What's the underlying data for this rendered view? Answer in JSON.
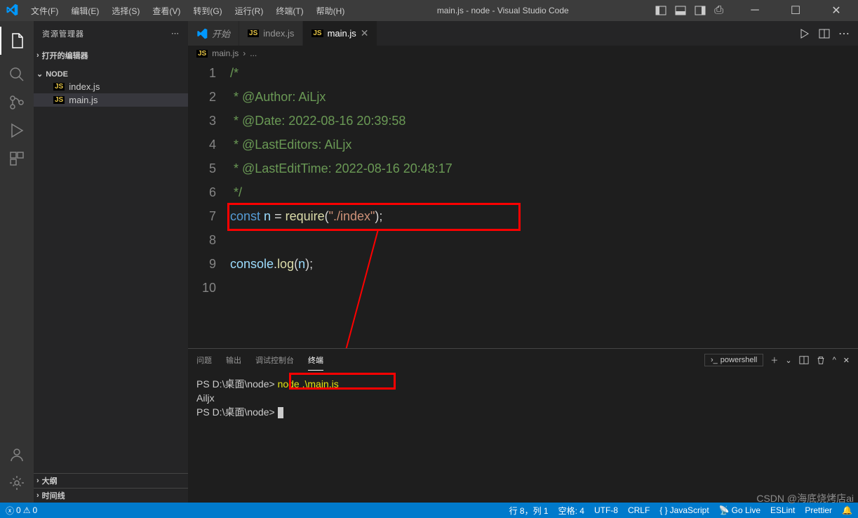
{
  "menu": [
    "文件(F)",
    "编辑(E)",
    "选择(S)",
    "查看(V)",
    "转到(G)",
    "运行(R)",
    "终端(T)",
    "帮助(H)"
  ],
  "title": "main.js - node - Visual Studio Code",
  "sidebar": {
    "header": "资源管理器",
    "openEditors": "打开的编辑器",
    "project": "NODE",
    "files": [
      "index.js",
      "main.js"
    ],
    "outline": "大纲",
    "timeline": "时间线"
  },
  "tabs": [
    {
      "label": "开始",
      "icon": "vscode"
    },
    {
      "label": "index.js",
      "icon": "js"
    },
    {
      "label": "main.js",
      "icon": "js",
      "active": true
    }
  ],
  "breadcrumb": {
    "file": "main.js",
    "sep": "›",
    "more": "..."
  },
  "code": {
    "line1": "/*",
    "line2": " * @Author: AiLjx",
    "line3": " * @Date: 2022-08-16 20:39:58",
    "line4": " * @LastEditors: AiLjx",
    "line5": " * @LastEditTime: 2022-08-16 20:48:17",
    "line6": " */",
    "l7_const": "const",
    "l7_n": "n",
    "l7_eq": " = ",
    "l7_req": "require",
    "l7_paren": "(",
    "l7_str": "\"./index\"",
    "l7_end": ");",
    "l9_obj": "console",
    "l9_dot": ".",
    "l9_log": "log",
    "l9_p1": "(",
    "l9_n": "n",
    "l9_p2": ");"
  },
  "panel": {
    "tabs": [
      "问题",
      "输出",
      "调试控制台",
      "终端"
    ],
    "shell": "powershell"
  },
  "terminal": {
    "prompt1": "PS D:\\桌面\\node> ",
    "cmd": "node .\\main.js",
    "output": "Ailjx",
    "prompt2": "PS D:\\桌面\\node> "
  },
  "status": {
    "errors": "0",
    "warnings": "0",
    "ln": "行 8，列 1",
    "spaces": "空格: 4",
    "encoding": "UTF-8",
    "eol": "CRLF",
    "lang": "JavaScript",
    "golive": "Go Live",
    "eslint": "ESLint",
    "prettier": "Prettier"
  },
  "watermark": "CSDN @海底烧烤店ai"
}
